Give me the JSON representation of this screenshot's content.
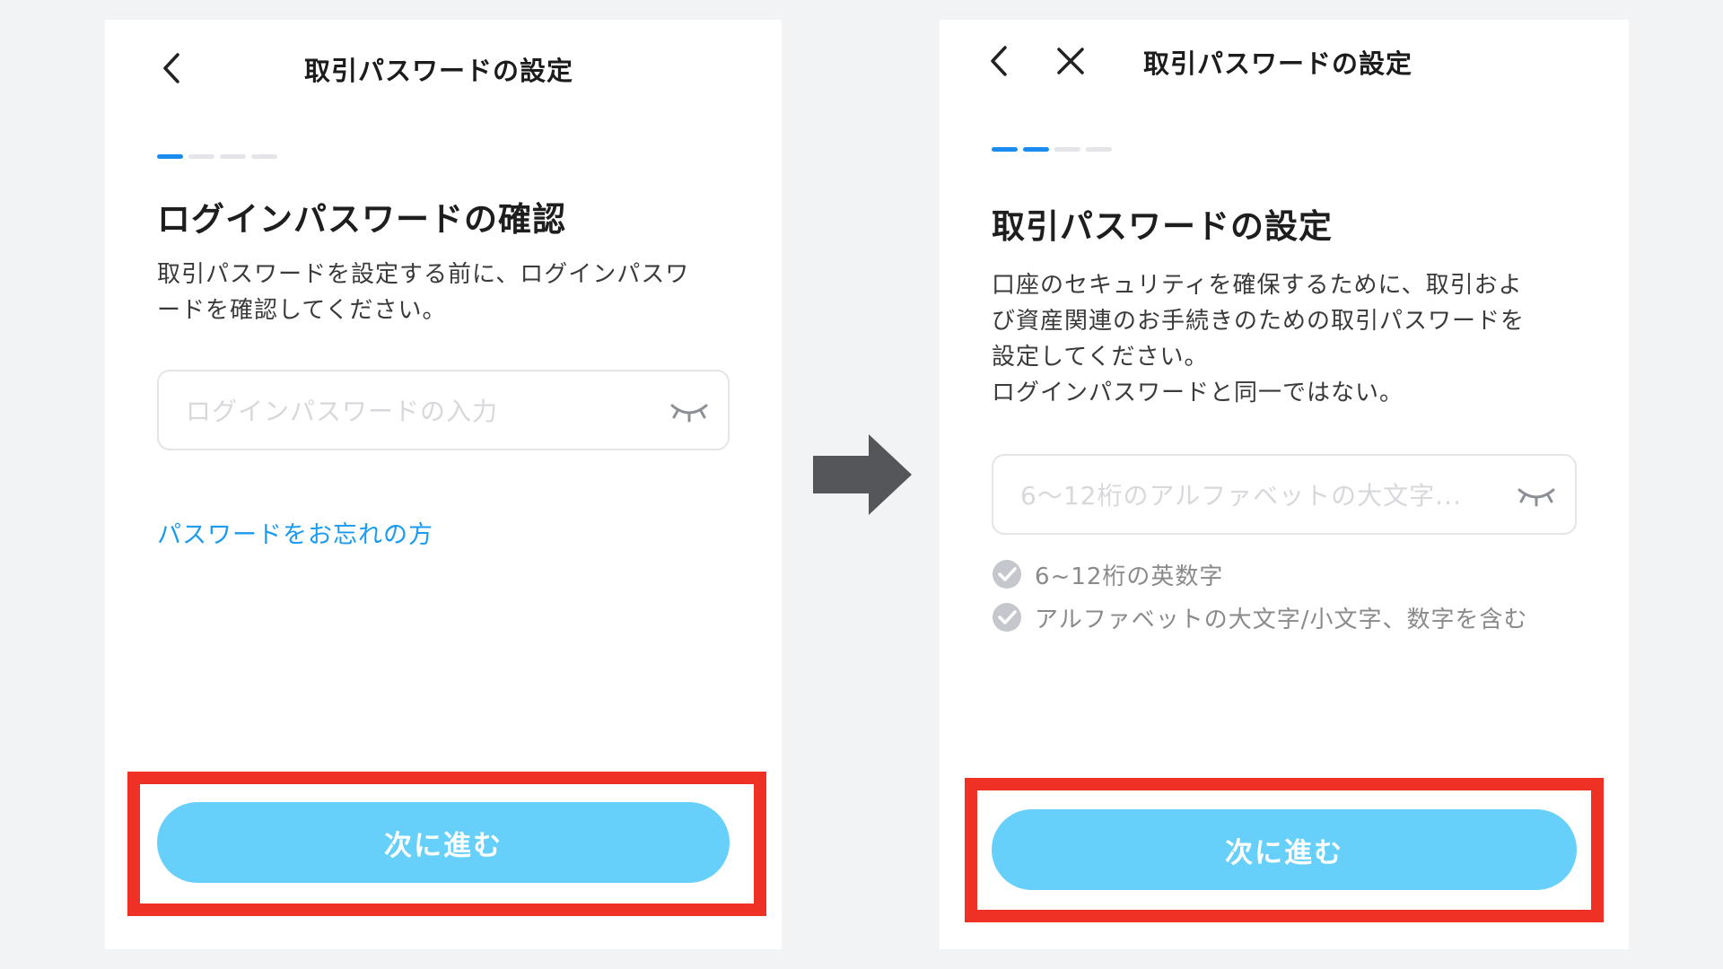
{
  "left": {
    "title": "取引パスワードの設定",
    "steps": [
      true,
      false,
      false,
      false
    ],
    "heading": "ログインパスワードの確認",
    "description": [
      "取引パスワードを設定する前に、ログインパスワ",
      "ードを確認してください。"
    ],
    "password_placeholder": "ログインパスワードの入力",
    "forgot_link": "パスワードをお忘れの方",
    "next_button": "次に進む"
  },
  "right": {
    "title": "取引パスワードの設定",
    "steps": [
      true,
      true,
      false,
      false
    ],
    "heading": "取引パスワードの設定",
    "description": [
      "口座のセキュリティを確保するために、取引およ",
      "び資産関連のお手続きのための取引パスワードを",
      "設定してください。",
      "ログインパスワードと同一ではない。"
    ],
    "password_placeholder": "6～12桁のアルファベットの大文字...",
    "rules": [
      "6~12桁の英数字",
      "アルファベットの大文字/小文字、数字を含む"
    ],
    "next_button": "次に進む"
  },
  "colors": {
    "accent_blue": "#1a8cf0",
    "button_blue": "#66d0fb",
    "link_blue": "#1a9bef",
    "highlight_red": "#ee3124",
    "arrow_gray": "#55565a"
  }
}
